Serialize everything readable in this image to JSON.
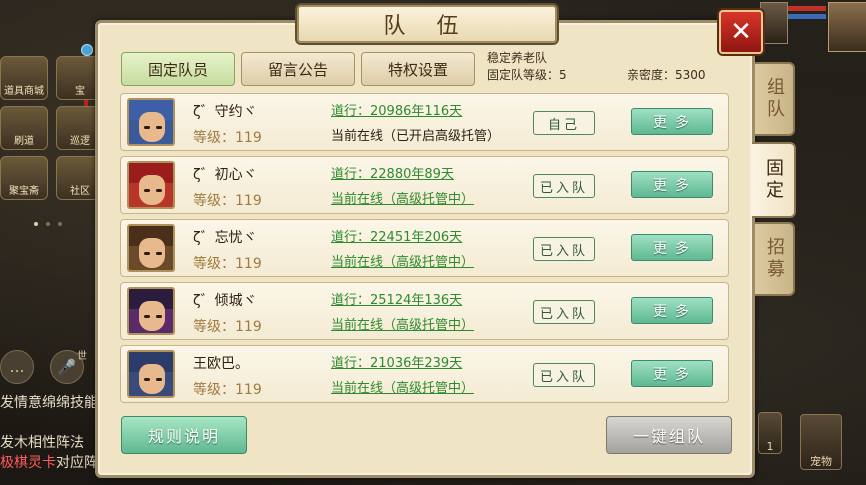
{
  "panel": {
    "title": "队 伍",
    "close_label": "✕"
  },
  "tabs": [
    {
      "label": "固定队员",
      "active": true
    },
    {
      "label": "留言公告",
      "active": false
    },
    {
      "label": "特权设置",
      "active": false
    }
  ],
  "team_info": {
    "team_name": "稳定养老队",
    "team_level": "固定队等级：5",
    "intimacy": "亲密度：5300"
  },
  "side_tabs": [
    {
      "label": "组队",
      "active": false
    },
    {
      "label": "固定",
      "active": true
    },
    {
      "label": "招募",
      "active": false
    }
  ],
  "members": [
    {
      "name": "ζ゛守约ヾ",
      "level": "等级：119",
      "daoxing": "道行：20986年116天",
      "online": "当前在线（已开启高级托管）",
      "status": "自己",
      "more": "更多",
      "hair": "#3c5fa8",
      "outfit": "#3a5a9a"
    },
    {
      "name": "ζ゛初心ヾ",
      "level": "等级：119",
      "daoxing": "道行：22880年89天",
      "online": "当前在线（高级托管中）",
      "status": "已入队",
      "more": "更多",
      "hair": "#9b1c1c",
      "outfit": "#b8352a"
    },
    {
      "name": "ζ゛忘忧ヾ",
      "level": "等级：119",
      "daoxing": "道行：22451年206天",
      "online": "当前在线（高级托管中）",
      "status": "已入队",
      "more": "更多",
      "hair": "#4a2f1a",
      "outfit": "#6b4a2a"
    },
    {
      "name": "ζ゛倾城ヾ",
      "level": "等级：119",
      "daoxing": "道行：25124年136天",
      "online": "当前在线（高级托管中）",
      "status": "已入队",
      "more": "更多",
      "hair": "#2a1c3c",
      "outfit": "#5a2a6a"
    },
    {
      "name": "王欧巴。",
      "level": "等级：119",
      "daoxing": "道行：21036年239天",
      "online": "当前在线（高级托管中）",
      "status": "已入队",
      "more": "更多",
      "hair": "#2c3c6a",
      "outfit": "#3a4a7a"
    }
  ],
  "buttons": {
    "rules": "规则说明",
    "one_key": "一键组队"
  },
  "left_menu": {
    "icons": [
      {
        "label": "道具商城",
        "icon": "shop-icon"
      },
      {
        "label": "宝",
        "icon": "treasure-icon"
      },
      {
        "label": "刷道",
        "icon": "quest-icon"
      },
      {
        "label": "巡逻",
        "icon": "patrol-icon"
      },
      {
        "label": "聚宝斋",
        "icon": "market-icon"
      },
      {
        "label": "社区",
        "icon": "community-icon"
      }
    ],
    "chat_icon": "…",
    "voice_badge": "世",
    "chat_lines": [
      {
        "text": "发情意绵绵技能",
        "highlight": ""
      },
      {
        "text": "发木相性阵法",
        "highlight": ""
      },
      {
        "text": "对应阵",
        "highlight": "极棋灵卡"
      }
    ]
  },
  "right_bottom": {
    "pet_label": "宠物",
    "badge": "1"
  },
  "colors": {
    "panel_bg": "#efe4c4",
    "accent_green": "#2e8a2c",
    "close_red": "#d8352b"
  }
}
